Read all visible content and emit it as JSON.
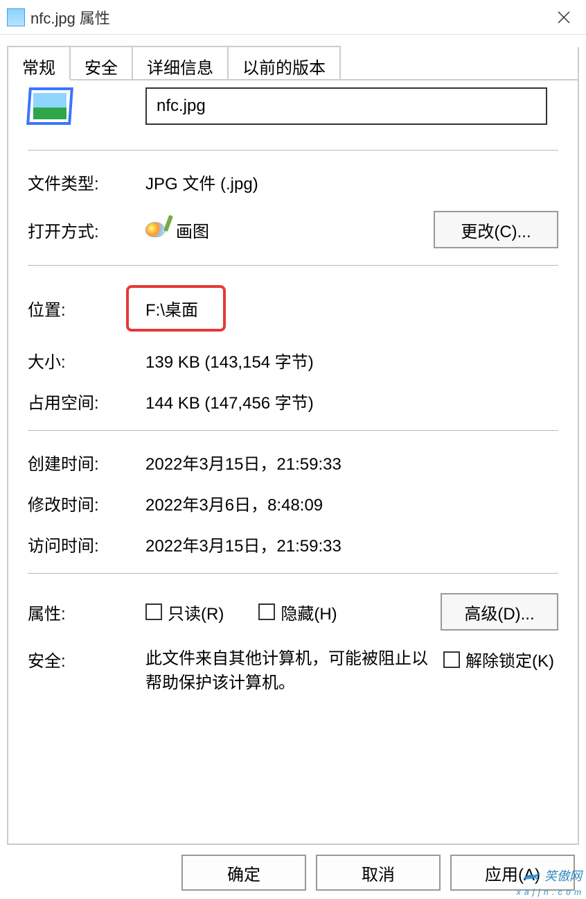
{
  "titlebar": {
    "title": "nfc.jpg 属性"
  },
  "tabs": [
    {
      "label": "常规",
      "active": true
    },
    {
      "label": "安全",
      "active": false
    },
    {
      "label": "详细信息",
      "active": false
    },
    {
      "label": "以前的版本",
      "active": false
    }
  ],
  "general": {
    "filename": "nfc.jpg",
    "filetype_label": "文件类型:",
    "filetype_value": "JPG 文件 (.jpg)",
    "openwith_label": "打开方式:",
    "openwith_app": "画图",
    "change_button": "更改(C)...",
    "location_label": "位置:",
    "location_value": "F:\\桌面",
    "size_label": "大小:",
    "size_value": "139 KB (143,154 字节)",
    "sizeondisk_label": "占用空间:",
    "sizeondisk_value": "144 KB (147,456 字节)",
    "created_label": "创建时间:",
    "created_value": "2022年3月15日，21:59:33",
    "modified_label": "修改时间:",
    "modified_value": "2022年3月6日，8:48:09",
    "accessed_label": "访问时间:",
    "accessed_value": "2022年3月15日，21:59:33",
    "attributes_label": "属性:",
    "readonly_label": "只读(R)",
    "hidden_label": "隐藏(H)",
    "advanced_button": "高级(D)...",
    "security_label": "安全:",
    "security_text": "此文件来自其他计算机，可能被阻止以帮助保护该计算机。",
    "unblock_label": "解除锁定(K)"
  },
  "buttons": {
    "ok": "确定",
    "cancel": "取消",
    "apply": "应用(A)"
  },
  "watermark": {
    "line1": "笑傲网",
    "line2": "x a j j n . c o m"
  }
}
